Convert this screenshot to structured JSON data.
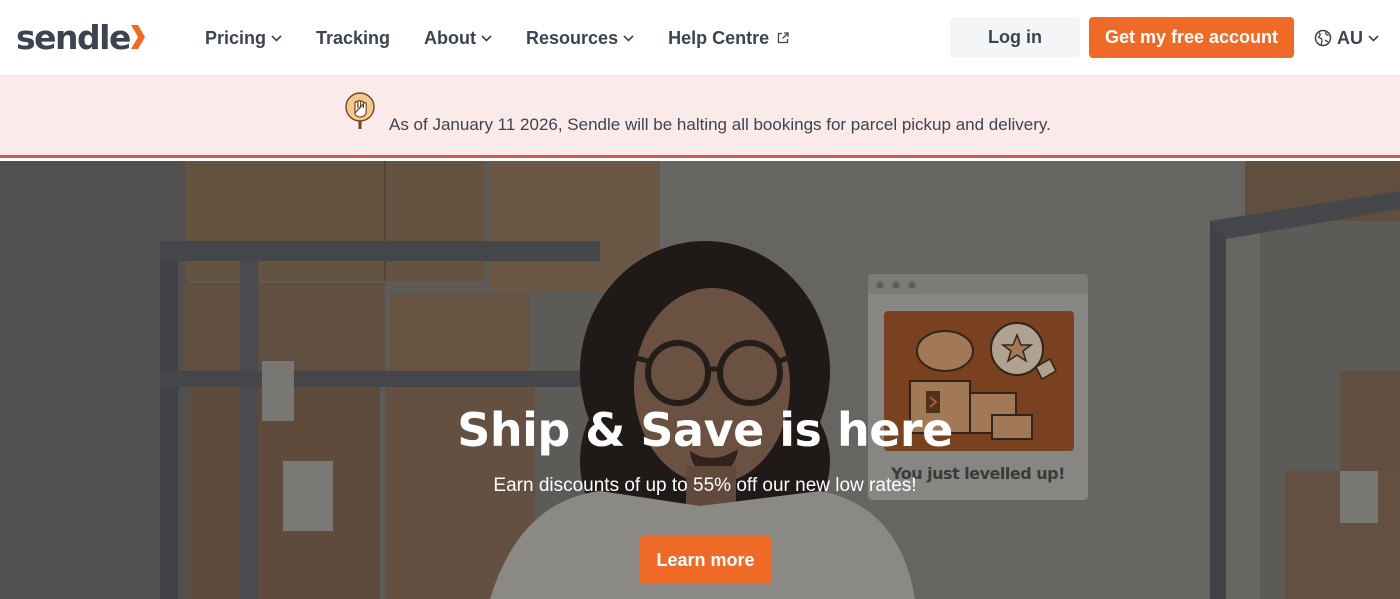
{
  "brand": {
    "name": "sendle",
    "primary_color": "#ef6a26",
    "text_color": "#3d4451"
  },
  "nav": {
    "items": [
      {
        "label": "Pricing",
        "has_dropdown": true
      },
      {
        "label": "Tracking",
        "has_dropdown": false
      },
      {
        "label": "About",
        "has_dropdown": true
      },
      {
        "label": "Resources",
        "has_dropdown": true
      },
      {
        "label": "Help Centre",
        "external": true
      }
    ],
    "login_label": "Log in",
    "signup_label": "Get my free account",
    "locale": "AU"
  },
  "banner": {
    "icon": "stop-hand-icon",
    "message": "As of January 11 2026, Sendle will be halting all bookings for parcel pickup and delivery.",
    "background_color": "#fbeaea",
    "border_color": "#d9534f"
  },
  "hero": {
    "title": "Ship & Save is here",
    "subtitle": "Earn discounts of up to 55% off our new low rates!",
    "cta_label": "Learn more",
    "card_caption": "You just levelled up!"
  }
}
